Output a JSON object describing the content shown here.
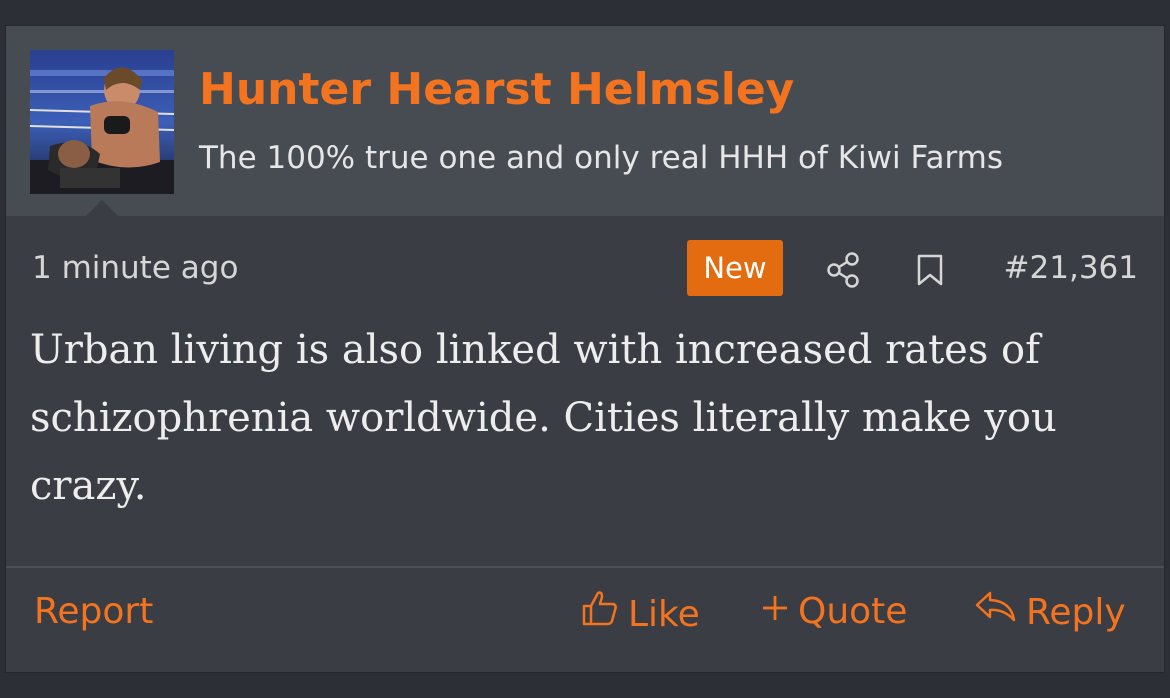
{
  "post": {
    "author": {
      "name": "Hunter Hearst Helmsley",
      "title": "The 100% true one and only real HHH of Kiwi Farms"
    },
    "meta": {
      "time": "1 minute ago",
      "badge": "New",
      "number": "#21,361"
    },
    "body": "Urban living is also linked with increased rates of schizophrenia worldwide. Cities literally make you crazy.",
    "actions": {
      "report": "Report",
      "like": "Like",
      "quote": "Quote",
      "reply": "Reply"
    }
  },
  "icons": {
    "avatar": "wrestler-avatar",
    "share": "share-icon",
    "bookmark": "bookmark-icon",
    "like": "thumbs-up-icon",
    "quote": "plus-icon",
    "reply": "reply-arrow-icon"
  },
  "colors": {
    "accent": "#f4731f",
    "badge": "#e36b10",
    "header_bg": "#474b52",
    "post_bg": "#3a3d43",
    "page_bg": "#2c2f35",
    "text": "#ededed"
  }
}
